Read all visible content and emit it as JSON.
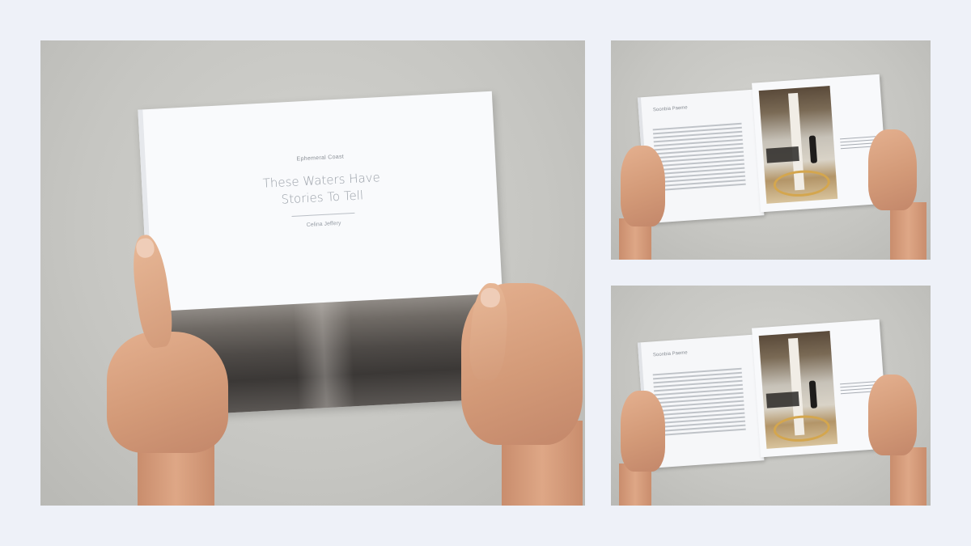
{
  "cover": {
    "series": "Ephemeral Coast",
    "title_line1": "These Waters Have",
    "title_line2": "Stories To Tell",
    "author": "Celina Jeffery"
  },
  "spread": {
    "heading": "Soonbia Paeme"
  },
  "colors": {
    "background": "#eef1f8",
    "photo_backdrop": "#c8c8c4",
    "cover_white": "#f9fafc",
    "skin": "#d9a07f"
  }
}
